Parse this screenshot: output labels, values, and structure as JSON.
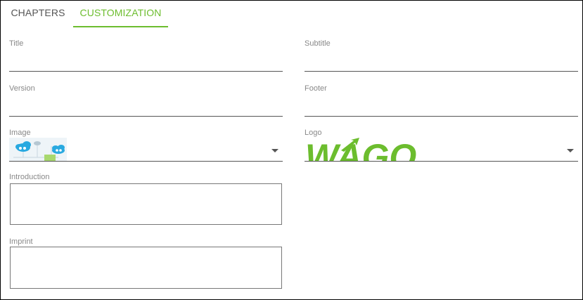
{
  "tabs": [
    {
      "label": "CHAPTERS",
      "active": false
    },
    {
      "label": "CUSTOMIZATION",
      "active": true
    }
  ],
  "form": {
    "title": {
      "label": "Title",
      "value": ""
    },
    "subtitle": {
      "label": "Subtitle",
      "value": ""
    },
    "version": {
      "label": "Version",
      "value": ""
    },
    "footer": {
      "label": "Footer",
      "value": ""
    },
    "image": {
      "label": "Image",
      "selected": "cloud-network-thumbnail"
    },
    "logo": {
      "label": "Logo",
      "selected": "WAGO",
      "text": "WAGO"
    },
    "introduction": {
      "label": "Introduction",
      "value": ""
    },
    "imprint": {
      "label": "Imprint",
      "value": ""
    }
  },
  "colors": {
    "accent": "#6cbd2e",
    "logo_green": "#6cbd2e",
    "cloud_blue": "#29a9e0"
  }
}
